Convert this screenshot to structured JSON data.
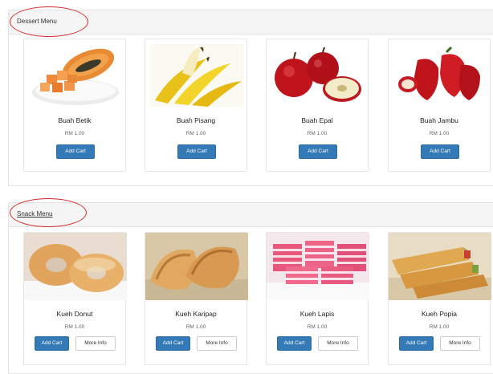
{
  "dessert_menu": {
    "title": "Dessert Menu",
    "items": [
      {
        "name": "Buah Betik",
        "price": "RM 1.00",
        "add_label": "Add Cart"
      },
      {
        "name": "Buah Pisang",
        "price": "RM 1.00",
        "add_label": "Add Cart"
      },
      {
        "name": "Buah Epal",
        "price": "RM 1.00",
        "add_label": "Add Cart"
      },
      {
        "name": "Buah Jambu",
        "price": "RM 1.00",
        "add_label": "Add Cart"
      }
    ]
  },
  "snack_menu": {
    "title": "Snack Menu",
    "items": [
      {
        "name": "Kueh Donut",
        "price": "RM 1.00",
        "add_label": "Add Cart",
        "info_label": "More Info"
      },
      {
        "name": "Kueh Karipap",
        "price": "RM 1.00",
        "add_label": "Add Cart",
        "info_label": "More Info"
      },
      {
        "name": "Kueh Lapis",
        "price": "RM 1.00",
        "add_label": "Add Cart",
        "info_label": "More Info"
      },
      {
        "name": "Kueh Popia",
        "price": "RM 1.00",
        "add_label": "Add Cart",
        "info_label": "More Info"
      }
    ]
  },
  "colors": {
    "annotation_circle": "#d42a2a",
    "primary_button": "#337ab7"
  }
}
